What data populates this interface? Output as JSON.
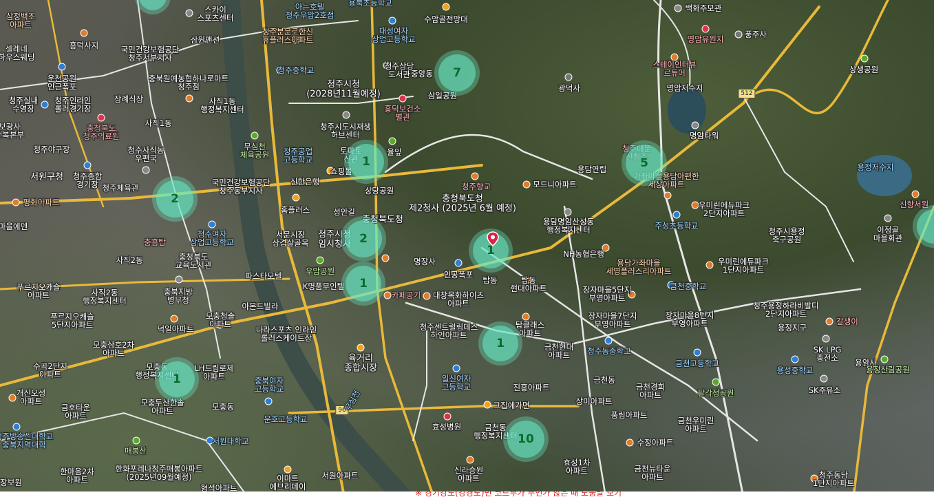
{
  "clusters": [
    {
      "id": "c1",
      "count": "7"
    },
    {
      "id": "c2",
      "count": "1"
    },
    {
      "id": "c3",
      "count": "5"
    },
    {
      "id": "c4",
      "count": "2"
    },
    {
      "id": "c5",
      "count": "2"
    },
    {
      "id": "c6",
      "count": "1"
    },
    {
      "id": "c7",
      "count": "1"
    },
    {
      "id": "c8",
      "count": "1"
    },
    {
      "id": "c9",
      "count": "1"
    },
    {
      "id": "c10",
      "count": "10"
    }
  ],
  "pin_label": "1",
  "roads": {
    "r512": "512",
    "r96": "96"
  },
  "labels": {
    "l1": "삼정백조\n아파트",
    "l2": "스카이\n스포츠센터",
    "l3": "아는호텔\n청주우암2호점",
    "l4": "용북초등학교",
    "l5": "수암골전망대",
    "l6": "백화주모관",
    "l7": "명암유원지",
    "l8": "풍주사",
    "l9": "청주분문로한신\n휴플러스아파트",
    "l10": "대성여자\n상업고등학교",
    "l11": "삼원맨션",
    "l12": "흥덕사지",
    "l13": "국민건강보험공단\n청주서부지사",
    "l14": "셀레네\n하우스웨딩",
    "l15": "청주중학교",
    "l16": "청주상당\n도서관",
    "l17": "중앙동",
    "l18": "스테이인터뷰\n르튜어",
    "l19": "상생공원",
    "l20": "운천공원\n인근폭포",
    "l21": "충북원예농협하나로마트\n청주점",
    "l22": "청주시청\n(2028년11월예정)",
    "l23": "삼일공원",
    "l24": "광덕사",
    "l25": "명암저수지",
    "l26": "청주실내\n수영장",
    "l27": "청주인라인\n롤러경기장",
    "l28": "장례식장",
    "l29": "사직1동\n행정복지센터",
    "l30": "흥덕보건소\n별관",
    "l31": "충청북도\n청주의료원",
    "l32": "사직1동",
    "l33": "청주시도시재생\n허브센터",
    "l34": "명암타워",
    "l35": "보광사\n건복본부",
    "l36": "청주야구장",
    "l37": "청주사직동\n우편국",
    "l38": "무심천\n체육공원",
    "l39": "청주공업\n고등학교",
    "l40": "토마토\n신관",
    "l41": "율잎",
    "l42": "용담연립",
    "l43": "청주대문\n신청주",
    "l44": "가좌마을용담아편한\n세상아파트",
    "l45": "서원구청",
    "l46": "청주종합\n경기장",
    "l47": "청주체육관",
    "l48": "국민건강보험공단\n청주동부지사",
    "l49": "신한은행",
    "l50": "쇼핑몰",
    "l51": "상당공원",
    "l52": "충청북도청\n제2청사 (2025년 6월 예정)",
    "l53": "청주향교",
    "l54": "모드니아파트",
    "l55": "용정저수지",
    "l56": "신항서원",
    "l57": "평화아파트",
    "l58": "홈플러스",
    "l59": "성안길",
    "l60": "충청북도청",
    "l61": "우미린에듀파크\n2단지아파트",
    "l62": "주성초등학교",
    "l63": "용담명암산성동\n행정복지센터",
    "l64": "이정골\n마을회관",
    "l65": "청주시용정\n축구공원",
    "l66": "마을에덴",
    "l67": "청주여자\n상업고등학교",
    "l68": "서문시장\n삼겹살골목",
    "l69": "청주시청\n임시청사",
    "l70": "충흥탑",
    "l71": "우암공원",
    "l72": "NH농협은행",
    "l73": "용담가좌마을\n세영플러스리아파트",
    "l74": "우미린에듀파크\n1단지아파트",
    "l75": "사직2동",
    "l76": "충청북도\n교육도서관",
    "l77": "파스타모텔",
    "l78": "명장사",
    "l79": "인공폭포",
    "l80": "탑동",
    "l81": "탑동\n현대아파트",
    "l82": "금천중학교",
    "l83": "푸르지오캐슬\n아파트",
    "l84": "사직2동\n행정복지센터",
    "l85": "충북지방\n병무청",
    "l86": "K명품무인텔",
    "l87": "대창목화하이츠\n아파트",
    "l88": "카페공기",
    "l89": "장자마을5단지\n부영아파트",
    "l90": "청주용정하라비발디\n2단지아파트",
    "l91": "용정지구",
    "l92": "푸르지오캐슬\n5단지아파트",
    "l93": "모충청솔\n아파트",
    "l94": "아몬드빌라",
    "l95": "나라스포츠 인라인\n롤러스케이트장",
    "l96": "청주센트럴림데스\n하인아파트",
    "l97": "장자마을7단지\n부영아파트",
    "l98": "장자마을8단지\n부영아파트",
    "l99": "갈생이",
    "l100": "덕일아파트",
    "l101": "탑클래스\n아파트",
    "l102": "금천현대\n아파트",
    "l103": "청주동중학교",
    "l104": "SK LPG\n충전소",
    "l105": "모충삼호2차\n아파트",
    "l106": "육거리\n종합시장",
    "l107": "수곡2단지\n아파트",
    "l108": "모충동\n행정복지센터",
    "l109": "LH드림로제\n아파트",
    "l110": "충북여자\n고등학교",
    "l111": "일신여자\n고등학교",
    "l112": "금천고등학교",
    "l113": "용성중학교",
    "l114": "용암사",
    "l115": "용정산림공원",
    "l116": "개신오성\n아파트",
    "l117": "진흥아파트",
    "l118": "금천동",
    "l119": "금천경희\n아파트",
    "l120": "팔각정공원",
    "l121": "SK주유소",
    "l122": "모충두산한솔\n아파트",
    "l123": "모충동",
    "l124": "운호고등학교",
    "l125": "금호타운\n아파트",
    "l126": "그집에가면",
    "l127": "상미아파트",
    "l128": "풍림아파트",
    "l129": "금천우미린\n아파트",
    "l130": "청주방송신대학교\n충북지역대학",
    "l131": "서원대학교",
    "l132": "효성병원",
    "l133": "금천동\n행정복지센터",
    "l134": "수정아파트",
    "l135": "매봉산",
    "l136": "한마음2차\n아파트",
    "l137": "한화포레나청주매봉아파트\n(2025년09월예정)",
    "l138": "신라승원\n아파트",
    "l139": "효성1차\n아파트",
    "l140": "금천뉴타운\n아파트",
    "l141": "이마트\n에브리데이",
    "l142": "서원아파트",
    "l143": "청주동남\n1단지아파트",
    "l144": "형석아파트",
    "l145": "장보원",
    "l146": "무심천"
  },
  "notice": "※ 경기강도(강경도)민 코드부가 부인가 않은 때 도움말 보기"
}
